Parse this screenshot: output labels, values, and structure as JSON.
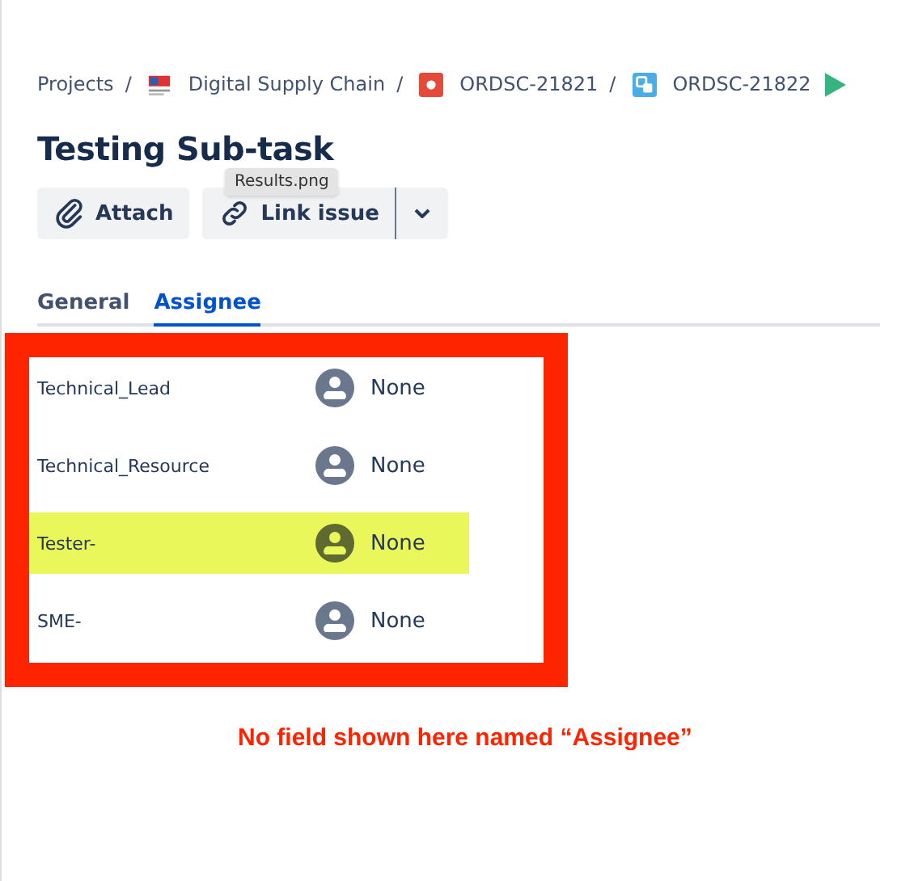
{
  "breadcrumbs": [
    {
      "label": "Projects",
      "kind": "text"
    },
    {
      "separator": "/",
      "label": "Digital Supply Chain",
      "kind": "project"
    },
    {
      "separator": "/",
      "label": "ORDSC-21821",
      "kind": "bug"
    },
    {
      "separator": "/",
      "label": "ORDSC-21822",
      "kind": "subtask"
    }
  ],
  "title": "Testing Sub-task",
  "buttons": [
    {
      "label": "Attach",
      "kind": "attach"
    },
    {
      "label": "Link issue",
      "kind": "link"
    }
  ],
  "tooltip": "Results.png",
  "tabs": [
    {
      "label": "General",
      "selected": false
    },
    {
      "label": "Assignee",
      "selected": true
    }
  ],
  "fields": [
    {
      "label": "Technical_Lead",
      "value": "None",
      "highlighted": false
    },
    {
      "label": "Technical_Resource",
      "value": "None",
      "highlighted": false
    },
    {
      "label": "Tester-",
      "value": "None",
      "highlighted": true
    },
    {
      "label": "SME-",
      "value": "None",
      "highlighted": false
    }
  ],
  "annotation": "No field shown here named “Assignee”"
}
